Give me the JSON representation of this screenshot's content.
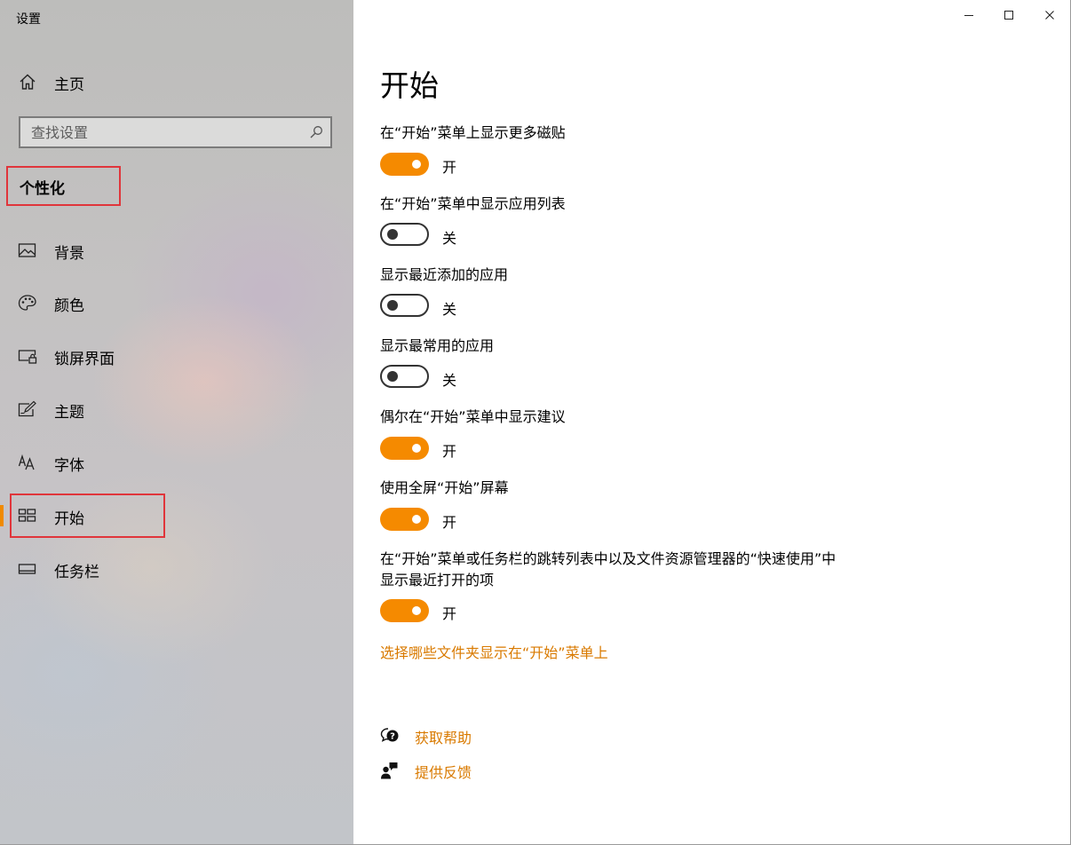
{
  "app": {
    "title": "设置"
  },
  "sidebar": {
    "home_label": "主页",
    "search_placeholder": "查找设置",
    "section_title": "个性化",
    "items": [
      {
        "label": "背景",
        "icon": "picture-icon"
      },
      {
        "label": "颜色",
        "icon": "palette-icon"
      },
      {
        "label": "锁屏界面",
        "icon": "lock-screen-icon"
      },
      {
        "label": "主题",
        "icon": "theme-pen-icon"
      },
      {
        "label": "字体",
        "icon": "font-icon"
      },
      {
        "label": "开始",
        "icon": "start-tiles-icon",
        "active": true
      },
      {
        "label": "任务栏",
        "icon": "taskbar-icon"
      }
    ]
  },
  "main": {
    "title": "开始",
    "settings": [
      {
        "label": "在“开始”菜单上显示更多磁贴",
        "state": "开",
        "on": true
      },
      {
        "label": "在“开始”菜单中显示应用列表",
        "state": "关",
        "on": false
      },
      {
        "label": "显示最近添加的应用",
        "state": "关",
        "on": false
      },
      {
        "label": "显示最常用的应用",
        "state": "关",
        "on": false
      },
      {
        "label": "偶尔在“开始”菜单中显示建议",
        "state": "开",
        "on": true
      },
      {
        "label": "使用全屏“开始”屏幕",
        "state": "开",
        "on": true
      },
      {
        "label_line1": "在“开始”菜单或任务栏的跳转列表中以及文件资源管理器的“快速使用”中",
        "label_line2": "显示最近打开的项",
        "state": "开",
        "on": true
      }
    ],
    "folders_link": "选择哪些文件夹显示在“开始”菜单上",
    "help_label": "获取帮助",
    "feedback_label": "提供反馈"
  },
  "colors": {
    "accent": "#f58a00",
    "link": "#d97a00",
    "highlight_box": "#e0353b"
  }
}
